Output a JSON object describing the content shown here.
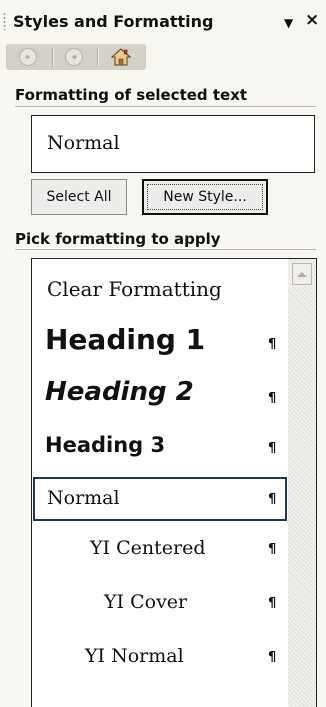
{
  "pane": {
    "title": "Styles and Formatting",
    "dropdown_icon": "▼",
    "close_icon": "×"
  },
  "nav": {
    "back_icon": "back-arrow-icon",
    "forward_icon": "forward-arrow-icon",
    "home_icon": "home-icon"
  },
  "selected": {
    "header": "Formatting of selected text",
    "value": "Normal",
    "select_all_label": "Select All",
    "new_style_label": "New Style..."
  },
  "pick": {
    "header": "Pick formatting to apply",
    "items": [
      {
        "label": "Clear Formatting",
        "mark": ""
      },
      {
        "label": "Heading 1",
        "mark": "¶"
      },
      {
        "label": "Heading 2",
        "mark": "¶"
      },
      {
        "label": "Heading 3",
        "mark": "¶"
      },
      {
        "label": "Normal",
        "mark": "¶"
      },
      {
        "label": "YI Centered",
        "mark": "¶"
      },
      {
        "label": "YI Cover",
        "mark": "¶"
      },
      {
        "label": "YI Normal",
        "mark": "¶"
      }
    ],
    "selected_index": 4
  },
  "colors": {
    "pane_bg": "#f7f6f1",
    "selection_border": "#1f3366",
    "toolbar_bg": "#d2d0c7"
  }
}
